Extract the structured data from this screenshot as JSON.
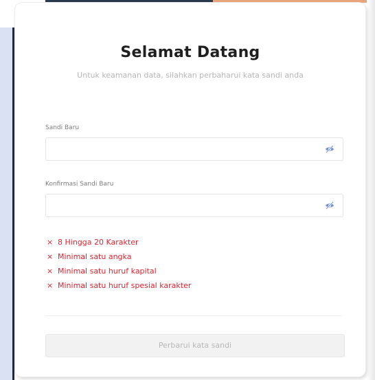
{
  "card": {
    "title": "Selamat Datang",
    "subtitle": "Untuk keamanan data, silahkan perbaharui kata sandi anda"
  },
  "fields": [
    {
      "label": "Sandi Baru",
      "value": "",
      "icon": "eye-slash-icon"
    },
    {
      "label": "Konfirmasi Sandi Baru",
      "value": "",
      "icon": "eye-slash-icon"
    }
  ],
  "rules": [
    {
      "text": "8 Hingga 20 Karakter",
      "status": "invalid"
    },
    {
      "text": "Minimal satu angka",
      "status": "invalid"
    },
    {
      "text": "Minimal satu huruf kapital",
      "status": "invalid"
    },
    {
      "text": "Minimal satu huruf spesial karakter",
      "status": "invalid"
    }
  ],
  "rule_mark": "×",
  "submit_label": "Perbarui kata sandi",
  "colors": {
    "error": "#e0212b",
    "eye_icon": "#6d8fd6",
    "button_disabled_bg": "#f2f2f2",
    "button_disabled_text": "#b8b8b8"
  }
}
